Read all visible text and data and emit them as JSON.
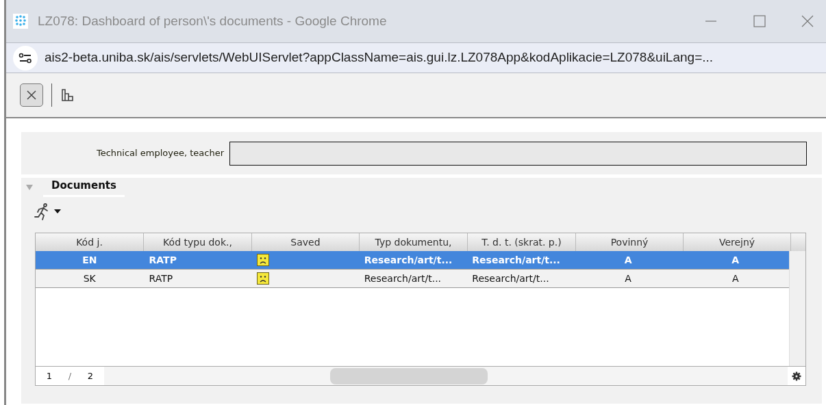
{
  "window": {
    "title": "LZ078: Dashboard of person\\'s documents - Google Chrome"
  },
  "address_bar": {
    "url": "ais2-beta.uniba.sk/ais/servlets/WebUIServlet?appClassName=ais.gui.lz.LZ078App&kodAplikacie=LZ078&uiLang=..."
  },
  "form": {
    "label": "Technical employee, teacher"
  },
  "documents": {
    "title": "Documents",
    "expanded": true,
    "table": {
      "columns": [
        "Kód j.",
        "Kód typu dok.,",
        "Saved",
        "Typ dokumentu,",
        "T. d. t. (skrat. p.)",
        "Povinný",
        "Verejný"
      ],
      "rows": [
        {
          "selected": true,
          "code": "EN",
          "type_code": "RATP",
          "saved": false,
          "doc_type": "Research/art/t...",
          "doc_type_short": "Research/art/t...",
          "mandatory": "A",
          "public": "A"
        },
        {
          "selected": false,
          "code": "SK",
          "type_code": "RATP",
          "saved": false,
          "doc_type": "Research/art/t...",
          "doc_type_short": "Research/art/t...",
          "mandatory": "A",
          "public": "A"
        }
      ]
    },
    "pager": {
      "page": "1",
      "separator": "/",
      "total": "2"
    }
  }
}
